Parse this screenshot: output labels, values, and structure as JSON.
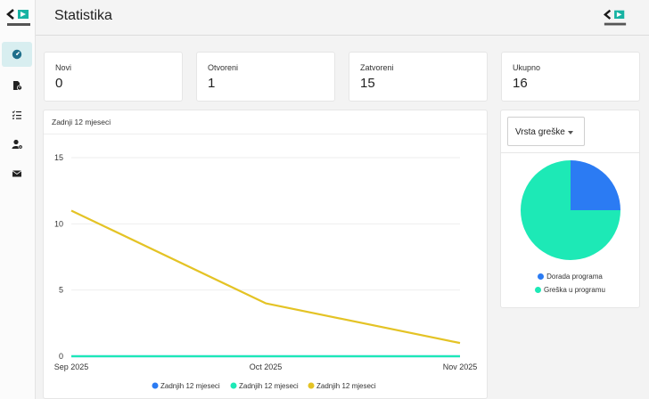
{
  "header": {
    "title": "Statistika"
  },
  "stats": [
    {
      "label": "Novi",
      "value": "0"
    },
    {
      "label": "Otvoreni",
      "value": "1"
    },
    {
      "label": "Zatvoreni",
      "value": "15"
    },
    {
      "label": "Ukupno",
      "value": "16"
    }
  ],
  "chart_card": {
    "title": "Zadnji 12 mjeseci"
  },
  "chart_data": [
    {
      "type": "line",
      "title": "",
      "xlabel": "",
      "ylabel": "",
      "x": [
        "Sep 2025",
        "Oct 2025",
        "Nov 2025"
      ],
      "ylim": [
        0,
        15
      ],
      "yticks": [
        0,
        5,
        10,
        15
      ],
      "grid": true,
      "legend_position": "bottom",
      "series": [
        {
          "name": "Zadnjih 12 mjeseci",
          "color": "#2b7bf3",
          "values": [
            0,
            0,
            0
          ]
        },
        {
          "name": "Zadnjih 12 mjeseci",
          "color": "#1de9b6",
          "values": [
            0,
            0,
            0
          ]
        },
        {
          "name": "Zadnjih 12 mjeseci",
          "color": "#e4c325",
          "values": [
            11,
            4,
            1
          ]
        }
      ]
    },
    {
      "type": "pie",
      "title": "",
      "legend_position": "bottom",
      "slices": [
        {
          "label": "Dorada programa",
          "value": 1,
          "color": "#2b7bf3"
        },
        {
          "label": "Greška u programu",
          "value": 3,
          "color": "#1de9b6"
        }
      ]
    }
  ],
  "pie_card": {
    "dropdown_label": "Vrsta greške"
  },
  "colors": {
    "accent": "#1de9b6",
    "active_nav_bg": "#d8eef0",
    "icon": "#222222"
  },
  "icons": {
    "logo": "code-brackets-logo",
    "nav": [
      "dashboard-icon",
      "file-alert-icon",
      "checklist-icon",
      "user-settings-icon",
      "envelope-icon"
    ]
  }
}
